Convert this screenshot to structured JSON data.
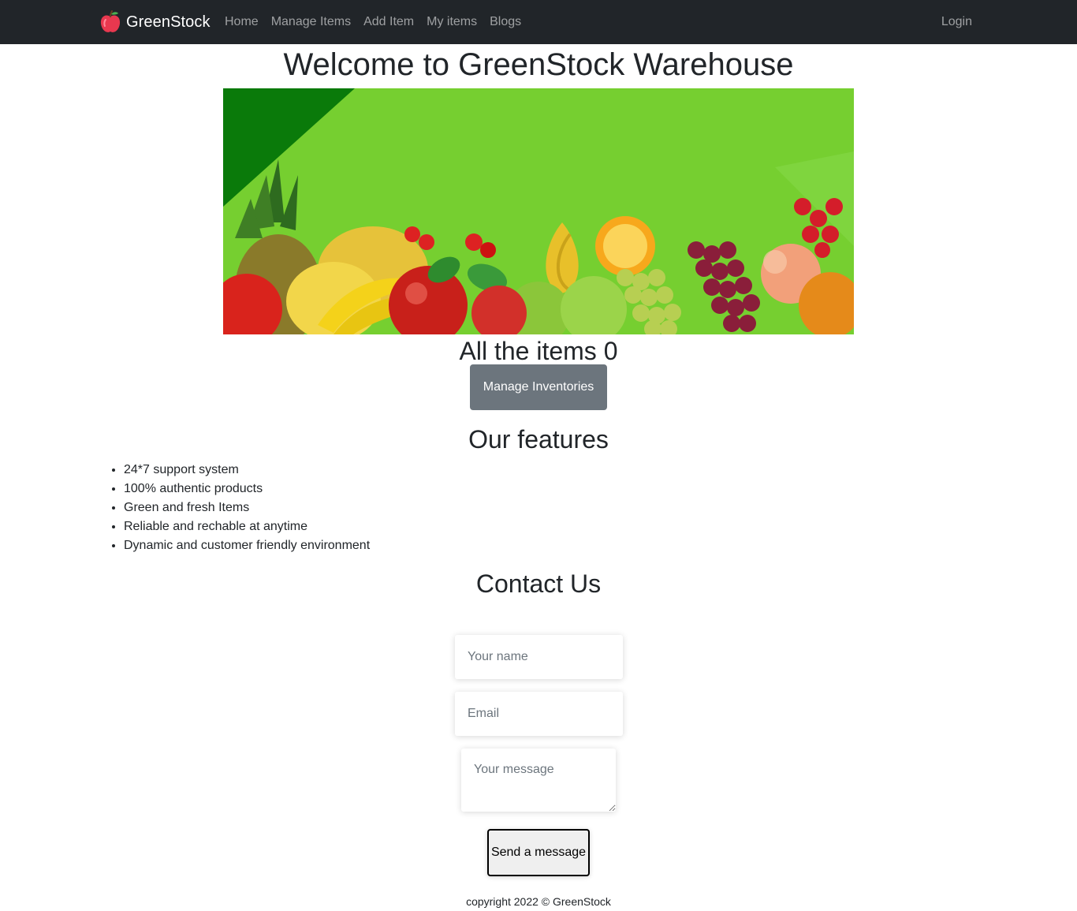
{
  "navbar": {
    "brand": "GreenStock",
    "links": [
      "Home",
      "Manage Items",
      "Add Item",
      "My items",
      "Blogs"
    ],
    "login": "Login"
  },
  "hero": {
    "title": "Welcome to GreenStock Warehouse",
    "banner_icon": "fruit-banner-image"
  },
  "items": {
    "heading": "All the items 0",
    "manage_button": "Manage Inventories"
  },
  "features": {
    "title": "Our features",
    "list": [
      "24*7 support system",
      "100% authentic products",
      "Green and fresh Items",
      "Reliable and rechable at anytime",
      "Dynamic and customer friendly environment"
    ]
  },
  "contact": {
    "title": "Contact Us",
    "name_placeholder": "Your name",
    "email_placeholder": "Email",
    "message_placeholder": "Your message",
    "send_button": "Send a message"
  },
  "footer": {
    "text": "copyright 2022 © GreenStock"
  },
  "colors": {
    "navbar_bg": "#212529",
    "banner_green": "#76cf30",
    "button_gray": "#6c757d"
  }
}
